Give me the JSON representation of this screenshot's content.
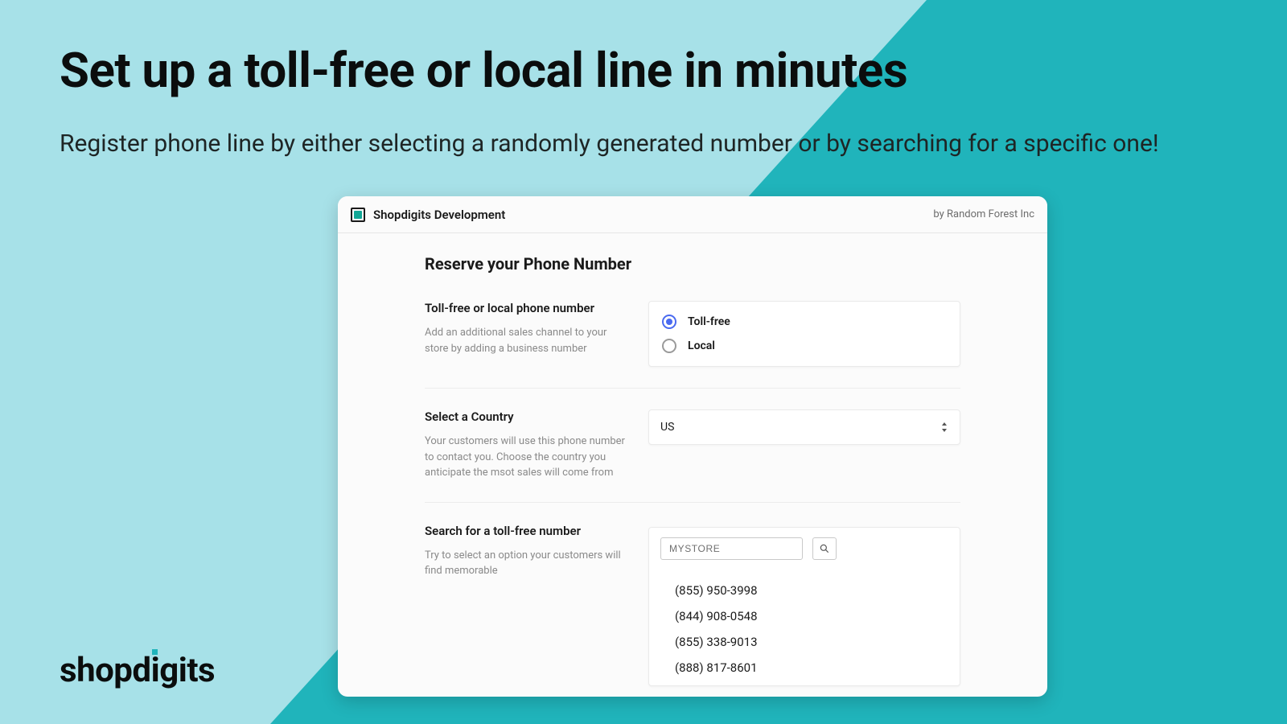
{
  "promo": {
    "headline": "Set up a toll-free or local line in minutes",
    "subhead": "Register phone line by either selecting a randomly generated number or by searching for a specific one!"
  },
  "brand": {
    "part1": "shopd",
    "accent": "i",
    "part2": "gits"
  },
  "app": {
    "title": "Shopdigits Development",
    "byline": "by Random Forest Inc"
  },
  "page": {
    "title": "Reserve your Phone Number"
  },
  "sections": {
    "type": {
      "heading": "Toll-free or local phone number",
      "desc": "Add an additional sales channel to your store by adding a business number",
      "options": [
        "Toll-free",
        "Local"
      ],
      "selected": "Toll-free"
    },
    "country": {
      "heading": "Select a Country",
      "desc": "Your customers will use this phone number to contact you. Choose the country you anticipate the msot sales will come from",
      "value": "US"
    },
    "search": {
      "heading": "Search for a toll-free number",
      "desc": "Try to select an option your customers will find memorable",
      "query": "MYSTORE",
      "results": [
        "(855) 950-3998",
        "(844) 908-0548",
        "(855) 338-9013",
        "(888) 817-8601"
      ]
    }
  }
}
